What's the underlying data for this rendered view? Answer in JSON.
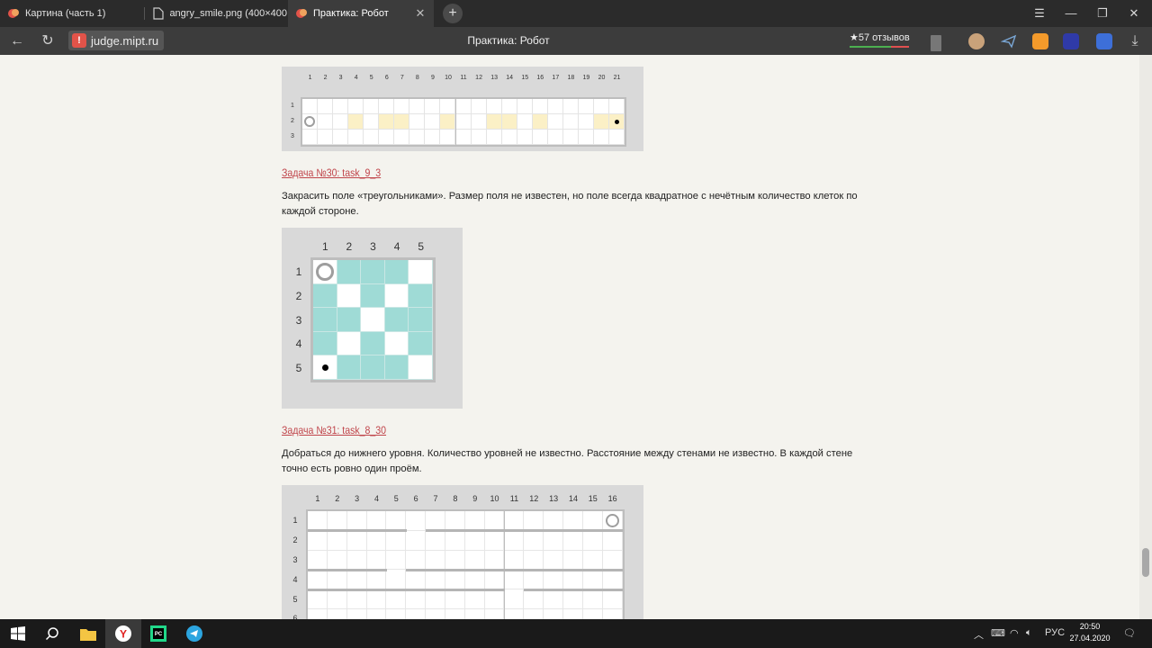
{
  "browser": {
    "tabs": [
      {
        "label": "Картина (часть 1)",
        "active": false
      },
      {
        "label": "angry_smile.png (400×400",
        "active": false
      },
      {
        "label": "Практика: Робот",
        "active": true
      }
    ],
    "domain": "judge.mipt.ru",
    "page_title": "Практика: Робот",
    "reviews": "★57 отзывов"
  },
  "field29": {
    "cols": [
      "1",
      "2",
      "3",
      "4",
      "5",
      "6",
      "7",
      "8",
      "9",
      "10",
      "11",
      "12",
      "13",
      "14",
      "15",
      "16",
      "17",
      "18",
      "19",
      "20",
      "21"
    ],
    "rows": [
      "1",
      "2",
      "3"
    ],
    "highlight_row2_cols": [
      4,
      6,
      7,
      10,
      13,
      14,
      16,
      20,
      21
    ],
    "robot": {
      "row": 2,
      "col": 1
    },
    "dot": {
      "row": 2,
      "col": 21
    }
  },
  "task30": {
    "link": "Задача №30: task_9_3",
    "description": "Закрасить поле «треугольниками». Размер поля не известен, но поле всегда квадратное с нечётным количество клеток по каждой стороне."
  },
  "field30": {
    "cols": [
      "1",
      "2",
      "3",
      "4",
      "5"
    ],
    "rows": [
      "1",
      "2",
      "3",
      "4",
      "5"
    ],
    "fill": [
      [
        0,
        1,
        1,
        1,
        0
      ],
      [
        1,
        0,
        1,
        0,
        1
      ],
      [
        1,
        1,
        0,
        1,
        1
      ],
      [
        1,
        0,
        1,
        0,
        1
      ],
      [
        0,
        1,
        1,
        1,
        0
      ]
    ],
    "robot": {
      "row": 1,
      "col": 1
    },
    "dot": {
      "row": 5,
      "col": 1
    },
    "fill_color": "#9fdbd6"
  },
  "task31": {
    "link": "Задача №31: task_8_30",
    "description": "Добраться до нижнего уровня. Количество уровней не известно. Расстояние между стенами не известно. В каждой стене точно есть ровно один проём."
  },
  "field31": {
    "cols": [
      "1",
      "2",
      "3",
      "4",
      "5",
      "6",
      "7",
      "8",
      "9",
      "10",
      "11",
      "12",
      "13",
      "14",
      "15",
      "16"
    ],
    "rows": [
      "1",
      "2",
      "3",
      "4",
      "5",
      "6"
    ],
    "walls": [
      {
        "below_row": 1,
        "gap_col": 6
      },
      {
        "below_row": 3,
        "gap_col": 5
      },
      {
        "below_row": 4,
        "gap_col": 11
      }
    ],
    "robot": {
      "row": 1,
      "col": 16
    }
  },
  "taskbar": {
    "lang": "РУС",
    "time": "20:50",
    "date": "27.04.2020"
  }
}
